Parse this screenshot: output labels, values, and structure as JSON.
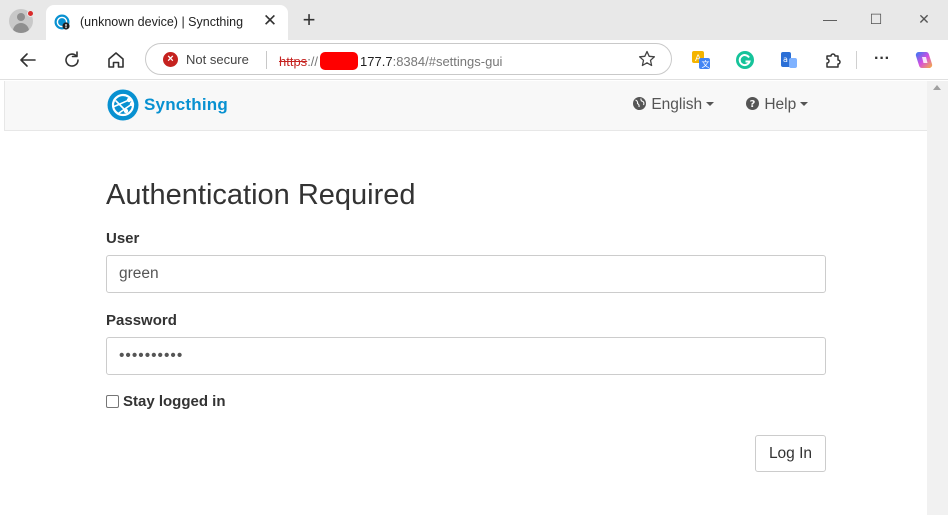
{
  "browser": {
    "tab": {
      "title": "(unknown device) | Syncthing",
      "close_glyph": "✕"
    },
    "new_tab_glyph": "+",
    "window_controls": {
      "minimize": "—",
      "maximize": "☐",
      "close": "✕"
    },
    "address_bar": {
      "security_label": "Not secure",
      "security_icon": "x-icon",
      "url_scheme": "https",
      "url_separator": "://",
      "url_host_suffix": "177.7",
      "url_rest": ":8384/#settings-gui"
    },
    "extensions": [
      "translate-icon",
      "grammarly-icon",
      "translator-icon",
      "extensions-puzzle-icon",
      "more-icon",
      "copilot-icon"
    ],
    "more_glyph": "···"
  },
  "app": {
    "brand": "Syncthing",
    "accent_color": "#0891d1",
    "nav": {
      "language": "English",
      "help": "Help"
    }
  },
  "login": {
    "heading": "Authentication Required",
    "user_label": "User",
    "user_value": "green",
    "password_label": "Password",
    "password_value": "••••••••••",
    "stay_logged_in": "Stay logged in",
    "stay_logged_in_checked": false,
    "submit": "Log In"
  }
}
